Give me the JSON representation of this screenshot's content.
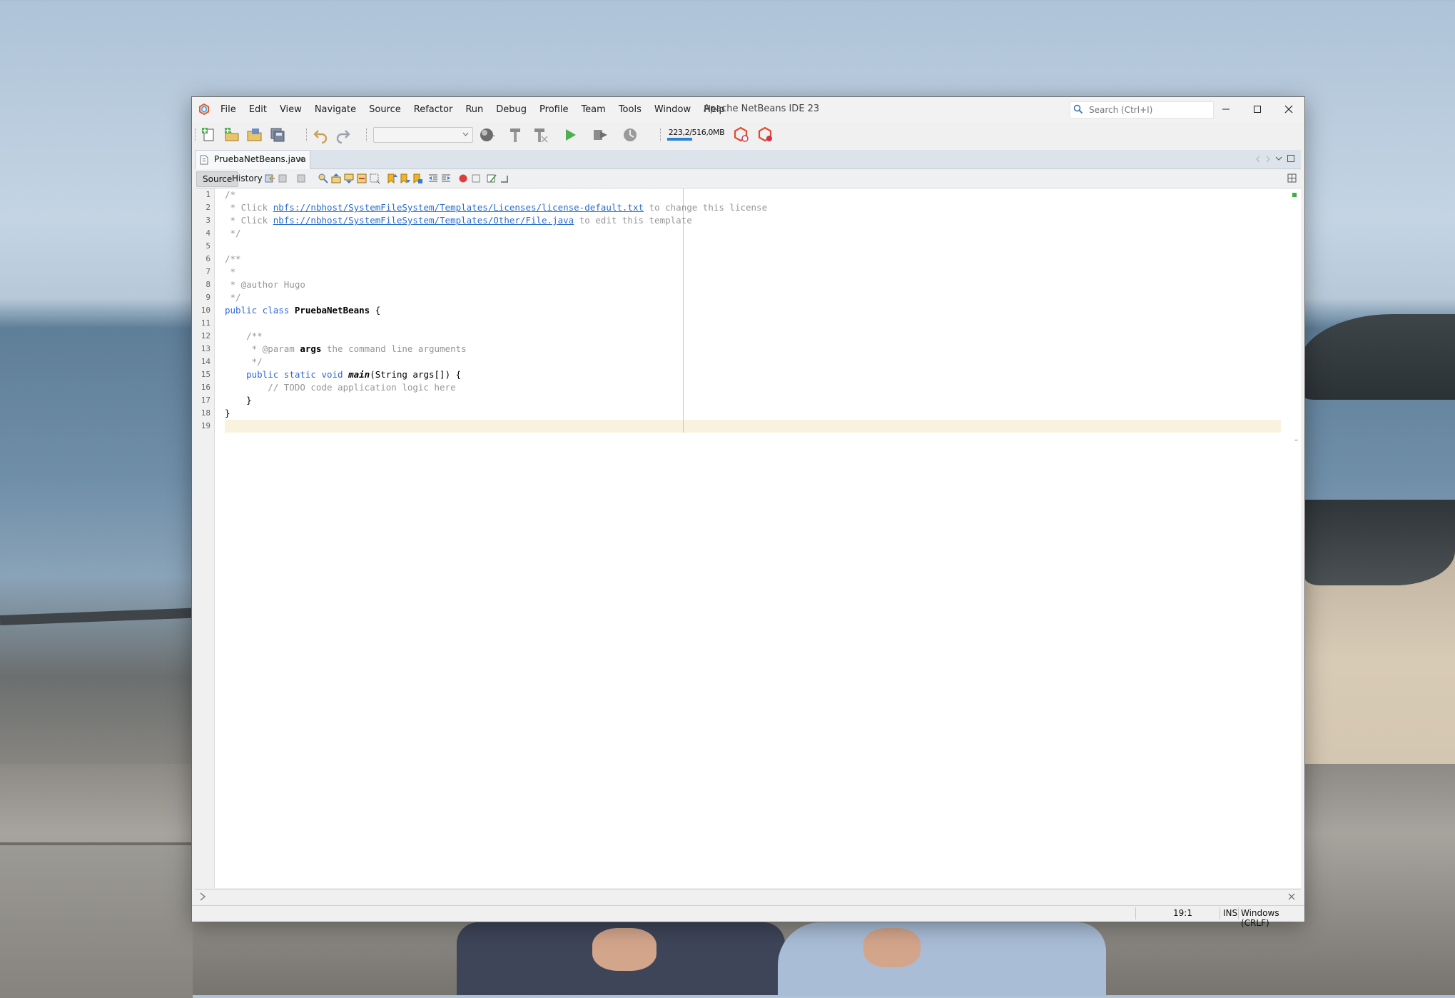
{
  "window": {
    "title": "Apache NetBeans IDE 23",
    "menu": [
      "File",
      "Edit",
      "View",
      "Navigate",
      "Source",
      "Refactor",
      "Run",
      "Debug",
      "Profile",
      "Team",
      "Tools",
      "Window",
      "Help"
    ],
    "search_placeholder": "Search (Ctrl+I)"
  },
  "toolbar": {
    "memory": "223,2/516,0MB",
    "memory_fraction": 0.43
  },
  "editor_tab": {
    "label": "PruebaNetBeans.java",
    "close": "×"
  },
  "editor_toolbar": {
    "source": "Source",
    "history": "History"
  },
  "code": {
    "line_numbers": [
      "1",
      "2",
      "3",
      "4",
      "5",
      "6",
      "7",
      "8",
      "9",
      "10",
      "11",
      "12",
      "13",
      "14",
      "15",
      "16",
      "17",
      "18",
      "19"
    ],
    "l1": "/*",
    "l2_pre": " * Click ",
    "l2_link": "nbfs://nbhost/SystemFileSystem/Templates/Licenses/license-default.txt",
    "l2_post": " to change this license",
    "l3_pre": " * Click ",
    "l3_link": "nbfs://nbhost/SystemFileSystem/Templates/Other/File.java",
    "l3_post": " to edit this template",
    "l4": " */",
    "l6": "/**",
    "l7": " *",
    "l8": " * @author Hugo",
    "l9": " */",
    "l10_kw": "public class ",
    "l10_name": "PruebaNetBeans",
    "l10_rest": " {",
    "l12": "    /**",
    "l13_pre": "     * @param ",
    "l13_arg": "args",
    "l13_post": " the command line arguments",
    "l14": "     */",
    "l15_indent": "    ",
    "l15_kw": "public static void ",
    "l15_name": "main",
    "l15_rest": "(String args[]) {",
    "l16": "        // TODO code application logic here",
    "l17": "    }",
    "l18": "}"
  },
  "status": {
    "position": "19:1",
    "mode": "INS",
    "line_ending": "Windows (CRLF)"
  }
}
